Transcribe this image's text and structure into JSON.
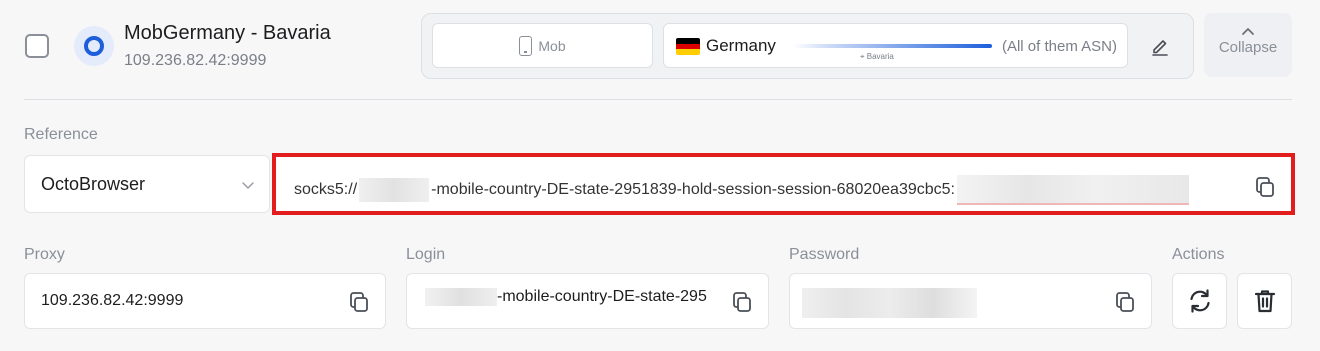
{
  "header": {
    "title": "MobGermany - Bavaria",
    "subtitle": "109.236.82.42:9999"
  },
  "geo": {
    "type_label": "Mob",
    "country": "Germany",
    "state_tag": "Bavaria",
    "asn": "(All of them ASN)",
    "flag_colors": [
      "#000000",
      "#dd0000",
      "#ffce00"
    ]
  },
  "collapse_label": "Collapse",
  "reference": {
    "label": "Reference",
    "selected": "OctoBrowser"
  },
  "connection": {
    "prefix": "socks5://",
    "middle": "-mobile-country-DE-state-2951839-hold-session-session-68020ea39cbc5:"
  },
  "proxy": {
    "label": "Proxy",
    "value": "109.236.82.42:9999"
  },
  "login": {
    "label": "Login",
    "value": "-mobile-country-DE-state-295"
  },
  "password": {
    "label": "Password"
  },
  "actions": {
    "label": "Actions"
  },
  "icons": [
    "phone-icon",
    "edit-icon",
    "chevron-up-icon",
    "chevron-down-icon",
    "copy-icon",
    "refresh-icon",
    "trash-icon"
  ],
  "colors": {
    "accent": "#1d5fdb",
    "highlight": "#e11d1d"
  }
}
